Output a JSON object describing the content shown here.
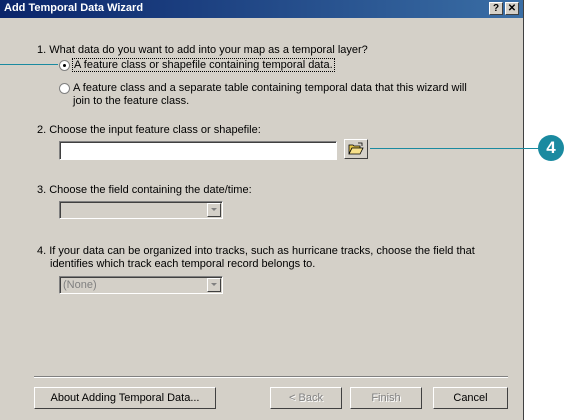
{
  "window": {
    "title": "Add Temporal Data Wizard",
    "help_button": "?",
    "close_button": "✕"
  },
  "q1": {
    "text": "1.  What data do you want to add into your map as a temporal layer?",
    "option1": "A feature class or shapefile containing temporal data.",
    "option2_line1": "A feature class and a separate table containing temporal data that this wizard will",
    "option2_line2": "join to the feature class.",
    "selected": "option1"
  },
  "q2": {
    "text": "2.   Choose the input feature class or shapefile:",
    "input_value": ""
  },
  "q3": {
    "text": "3.  Choose the field containing the date/time:",
    "combo_value": ""
  },
  "q4": {
    "text_line1": "4.  If your data can be organized into tracks, such as hurricane tracks, choose the field that",
    "text_line2": "identifies which track each temporal record belongs to.",
    "combo_value": "(None)"
  },
  "buttons": {
    "about": "About Adding Temporal Data...",
    "back": "< Back",
    "finish": "Finish",
    "cancel": "Cancel"
  },
  "callouts": {
    "badge_number": "4",
    "color": "#1a8aa0"
  },
  "icons": {
    "browse": "open-folder-icon"
  }
}
